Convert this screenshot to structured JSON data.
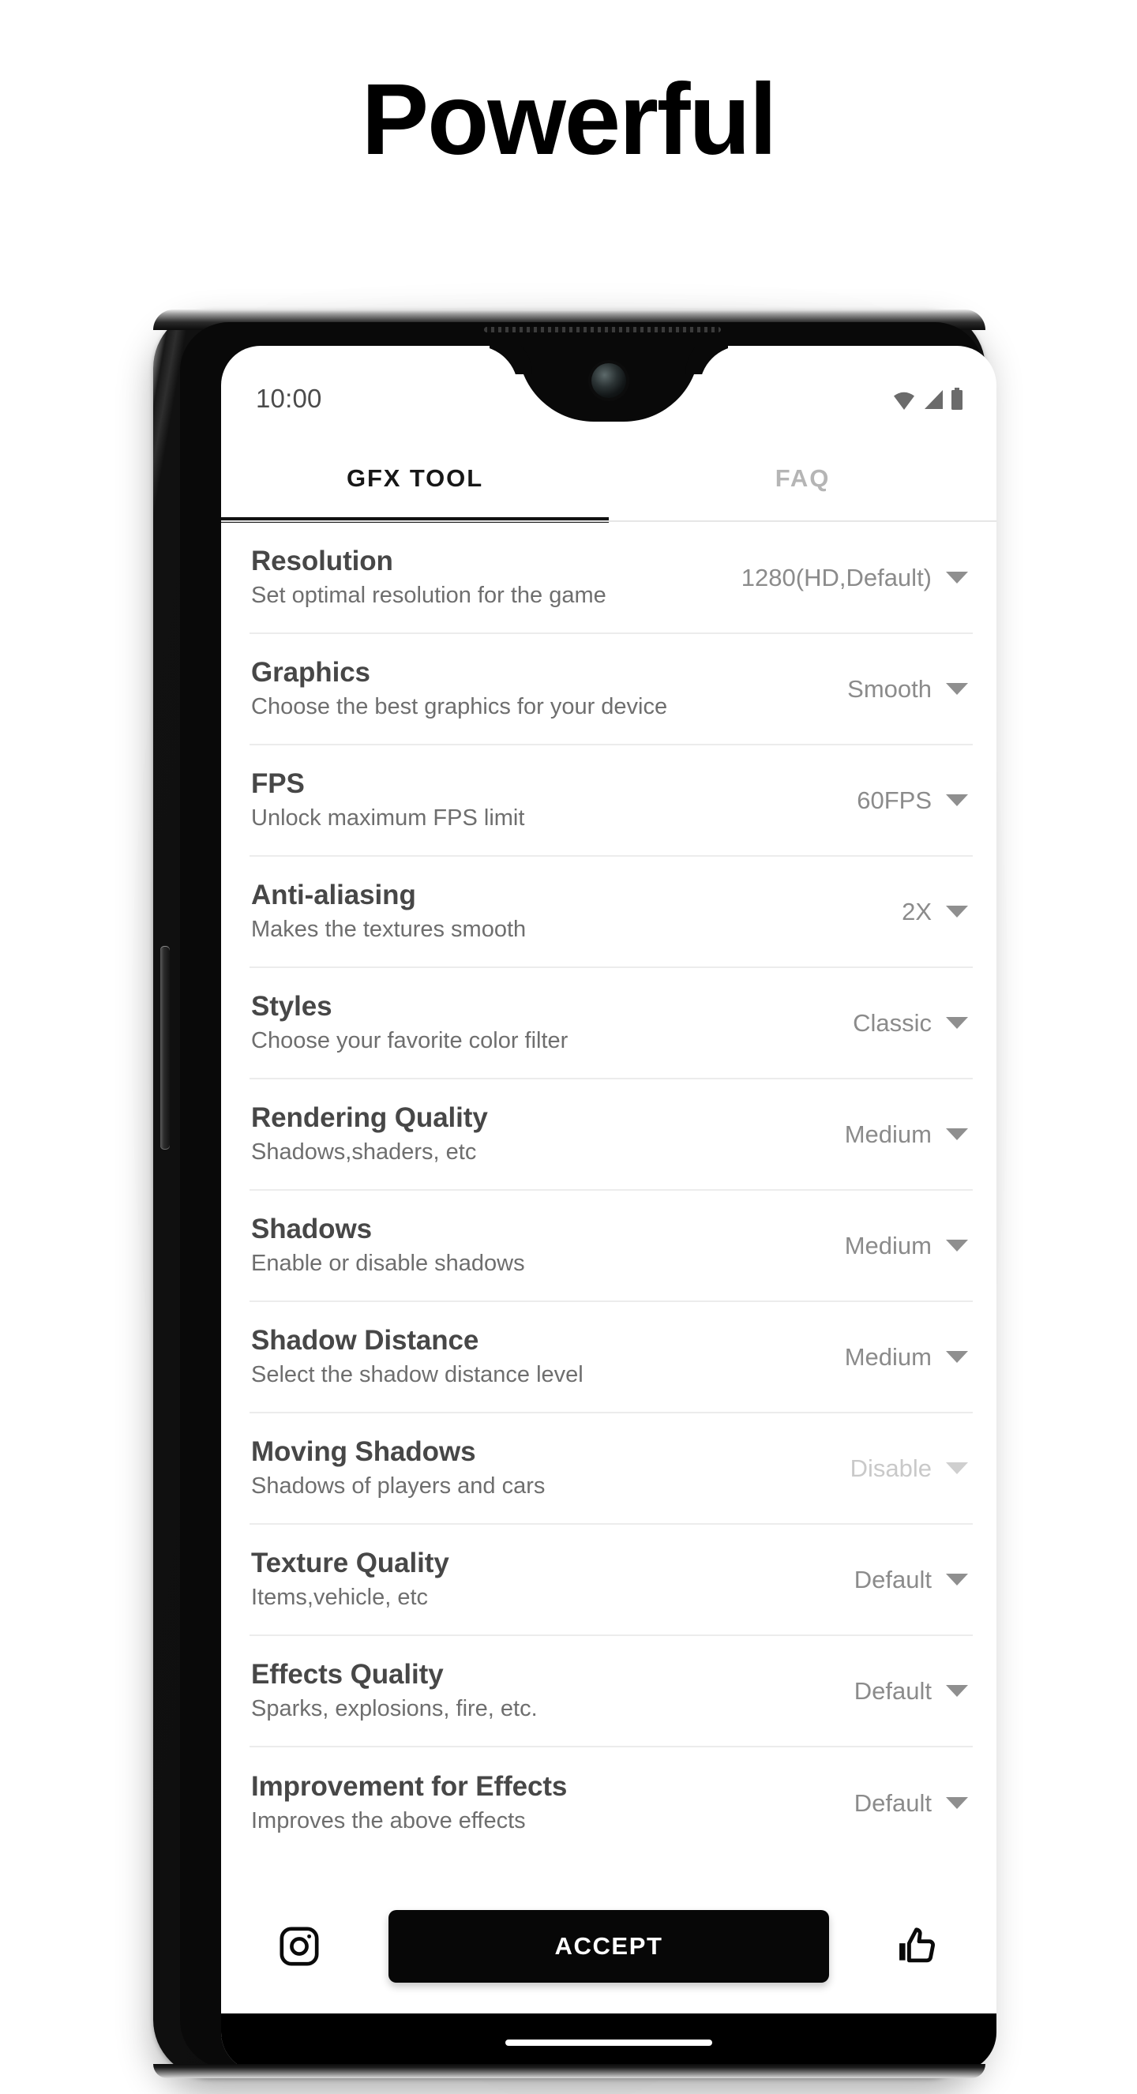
{
  "page": {
    "headline": "Powerful",
    "background_color": "#ffffff"
  },
  "statusbar": {
    "time": "10:00",
    "icons": [
      "wifi-icon",
      "cellular-signal-icon",
      "battery-icon"
    ],
    "icon_color": "#6b6b6b"
  },
  "tabs": [
    {
      "label": "GFX TOOL",
      "active": true
    },
    {
      "label": "FAQ",
      "active": false
    }
  ],
  "settings": [
    {
      "title": "Resolution",
      "subtitle": "Set optimal resolution for the game",
      "value": "1280(HD,Default)",
      "dim": false
    },
    {
      "title": "Graphics",
      "subtitle": "Choose the best graphics for your device",
      "value": "Smooth",
      "dim": false
    },
    {
      "title": "FPS",
      "subtitle": "Unlock maximum FPS limit",
      "value": "60FPS",
      "dim": false
    },
    {
      "title": "Anti-aliasing",
      "subtitle": "Makes the textures smooth",
      "value": "2X",
      "dim": false
    },
    {
      "title": "Styles",
      "subtitle": "Choose your favorite color filter",
      "value": "Classic",
      "dim": false
    },
    {
      "title": "Rendering Quality",
      "subtitle": "Shadows,shaders, etc",
      "value": "Medium",
      "dim": false
    },
    {
      "title": "Shadows",
      "subtitle": "Enable or disable shadows",
      "value": "Medium",
      "dim": false
    },
    {
      "title": "Shadow Distance",
      "subtitle": "Select the shadow distance level",
      "value": "Medium",
      "dim": false
    },
    {
      "title": "Moving Shadows",
      "subtitle": "Shadows of players and cars",
      "value": "Disable",
      "dim": true
    },
    {
      "title": "Texture Quality",
      "subtitle": "Items,vehicle, etc",
      "value": "Default",
      "dim": false
    },
    {
      "title": "Effects Quality",
      "subtitle": "Sparks, explosions, fire, etc.",
      "value": "Default",
      "dim": false
    },
    {
      "title": "Improvement for Effects",
      "subtitle": "Improves the above effects",
      "value": "Default",
      "dim": false
    }
  ],
  "actionbar": {
    "instagram_icon": "instagram-icon",
    "accept_label": "ACCEPT",
    "like_icon": "thumbs-up-icon",
    "accept_bg": "#070707",
    "accept_text_color": "#ffffff"
  },
  "colors": {
    "title": "#474747",
    "subtitle": "#6e6e6e",
    "value": "#8b8b8b",
    "value_dim": "#c9c9c9",
    "tab_active": "#171717",
    "tab_inactive": "#b5b5b5",
    "divider": "#ececec",
    "navbar": "#000000"
  }
}
